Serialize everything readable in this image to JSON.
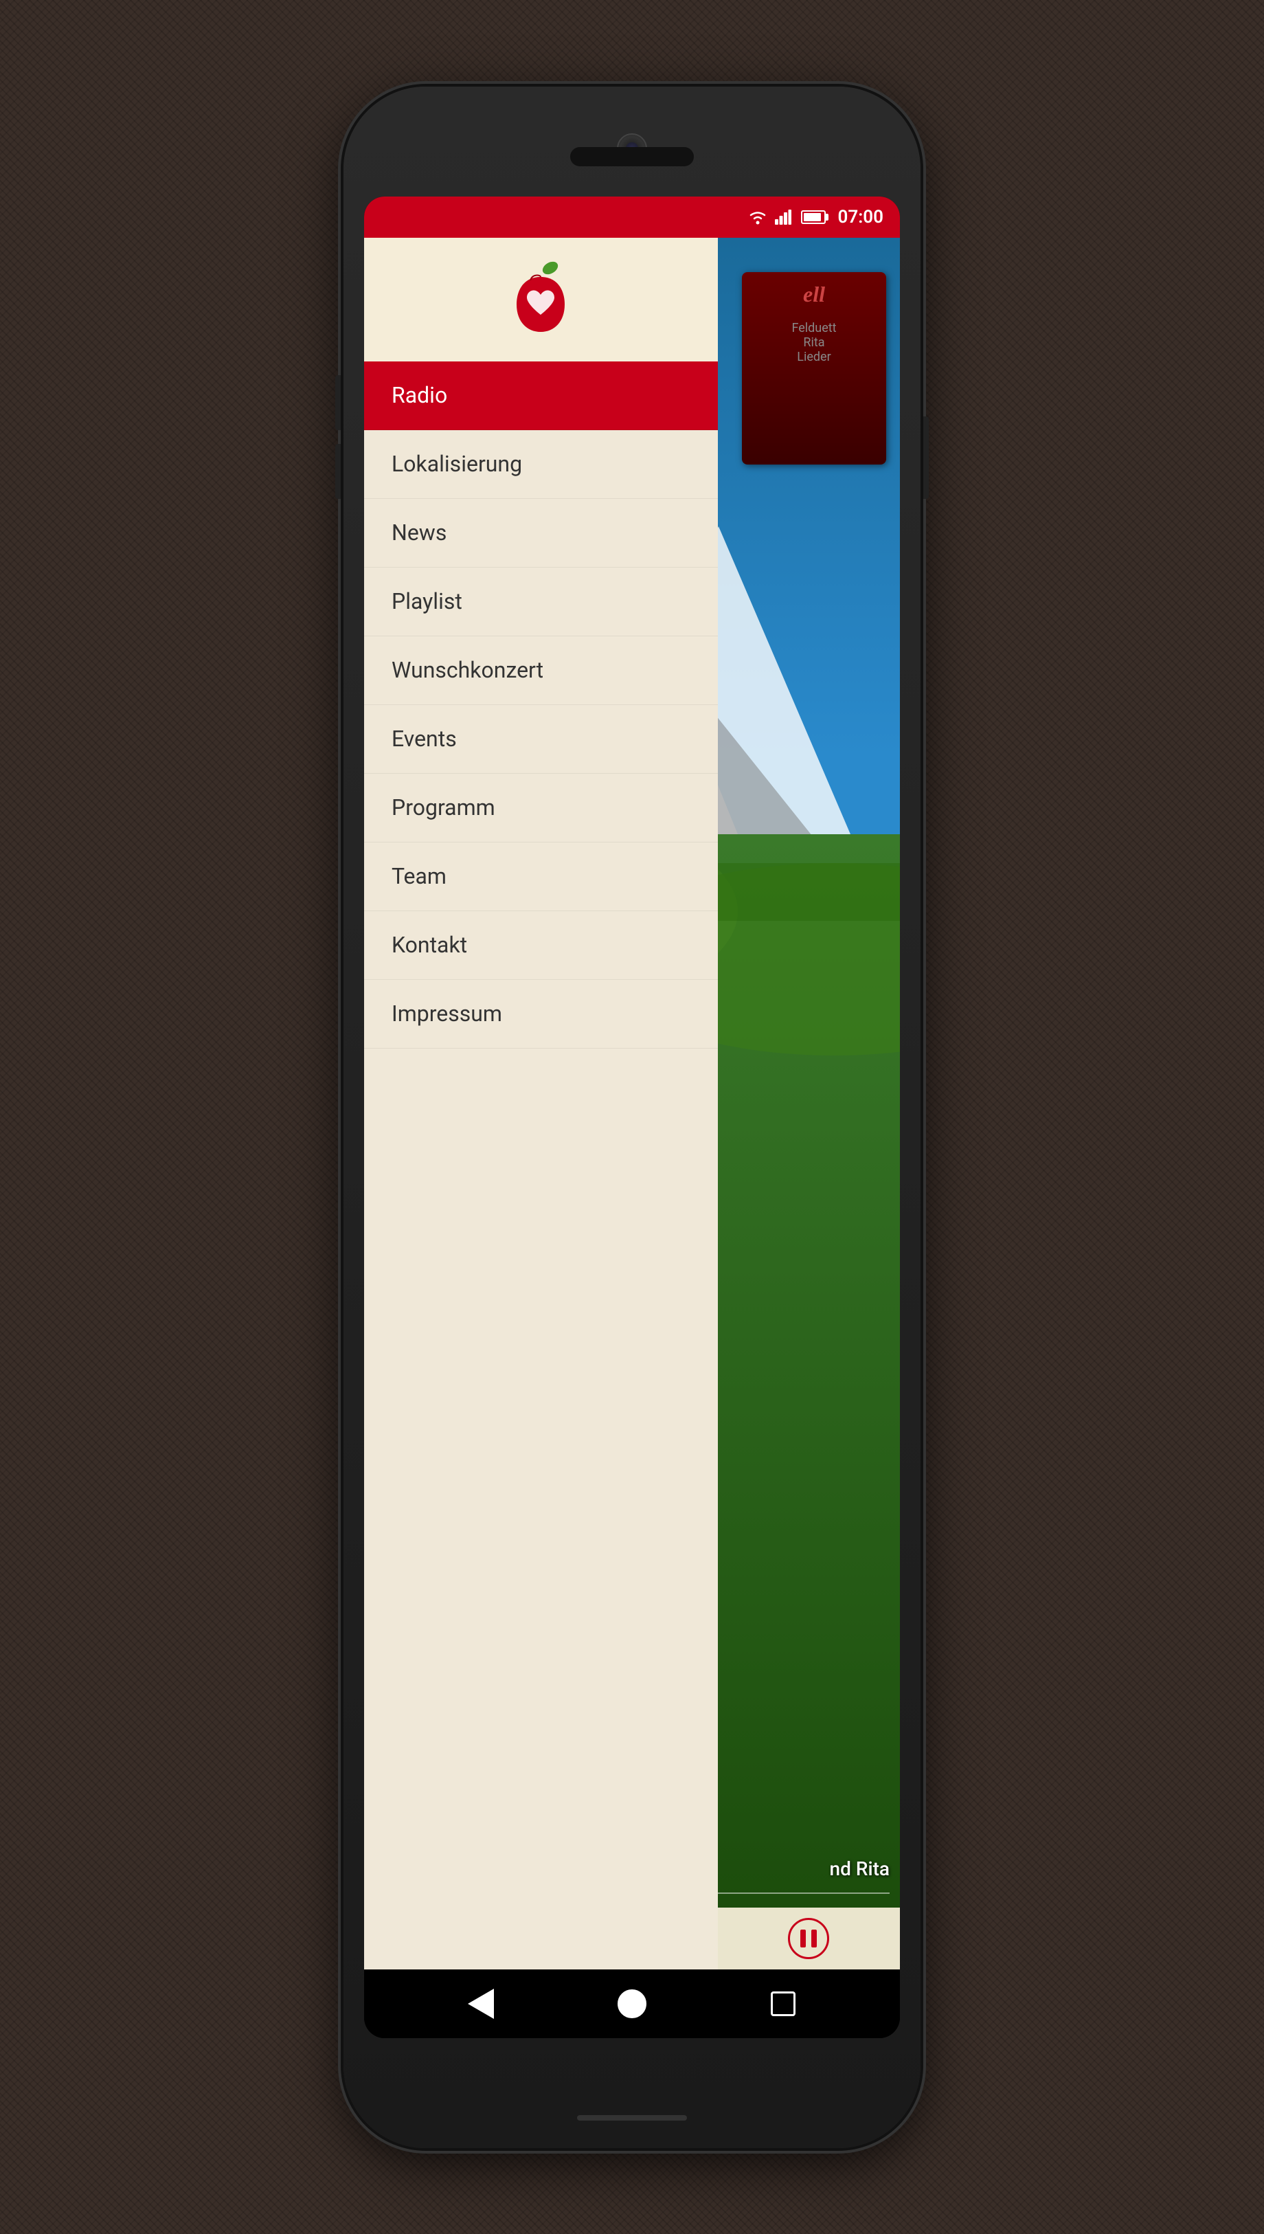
{
  "status_bar": {
    "time": "07:00",
    "wifi": "wifi",
    "signal": "signal",
    "battery": "battery"
  },
  "drawer": {
    "logo_alt": "Radio App Logo - Apple with heart",
    "menu_items": [
      {
        "id": "radio",
        "label": "Radio",
        "active": true
      },
      {
        "id": "lokalisierung",
        "label": "Lokalisierung",
        "active": false
      },
      {
        "id": "news",
        "label": "News",
        "active": false
      },
      {
        "id": "playlist",
        "label": "Playlist",
        "active": false
      },
      {
        "id": "wunschkonzert",
        "label": "Wunschkonzert",
        "active": false
      },
      {
        "id": "events",
        "label": "Events",
        "active": false
      },
      {
        "id": "programm",
        "label": "Programm",
        "active": false
      },
      {
        "id": "team",
        "label": "Team",
        "active": false
      },
      {
        "id": "kontakt",
        "label": "Kontakt",
        "active": false
      },
      {
        "id": "impressum",
        "label": "Impressum",
        "active": false
      }
    ]
  },
  "player": {
    "artist": "nd Rita",
    "pause_button_label": "Pause"
  },
  "nav": {
    "back": "back",
    "home": "home",
    "recent": "recent-apps"
  },
  "album": {
    "title": "ell",
    "subtitle": "Lieder"
  }
}
